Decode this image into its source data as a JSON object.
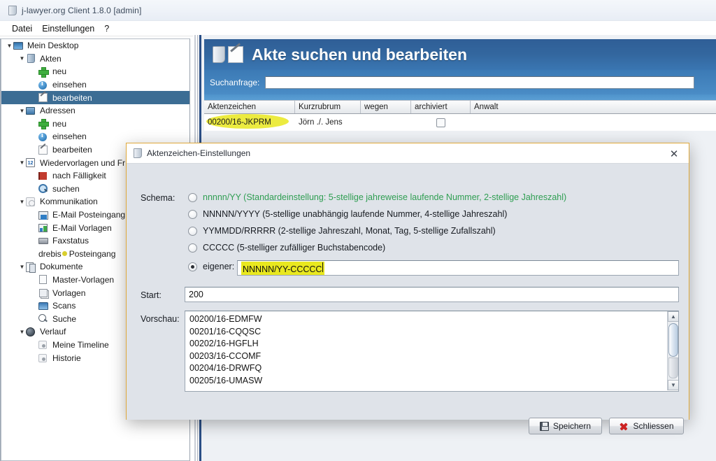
{
  "window": {
    "title": "j-lawyer.org Client 1.8.0 [admin]",
    "icon": "app-folder-icon",
    "menu": [
      "Datei",
      "Einstellungen",
      "?"
    ]
  },
  "sidebar": {
    "items": [
      {
        "label": "Mein Desktop",
        "depth": 0,
        "twisty": "▼",
        "icon": "desktop-icon",
        "selected": false
      },
      {
        "label": "Akten",
        "depth": 1,
        "twisty": "▼",
        "icon": "folder-icon",
        "selected": false
      },
      {
        "label": "neu",
        "depth": 2,
        "twisty": "",
        "icon": "plus-icon",
        "selected": false
      },
      {
        "label": "einsehen",
        "depth": 2,
        "twisty": "",
        "icon": "info-icon",
        "selected": false
      },
      {
        "label": "bearbeiten",
        "depth": 2,
        "twisty": "",
        "icon": "pencil-icon",
        "selected": true
      },
      {
        "label": "Adressen",
        "depth": 1,
        "twisty": "▼",
        "icon": "address-icon",
        "selected": false
      },
      {
        "label": "neu",
        "depth": 2,
        "twisty": "",
        "icon": "plus-icon",
        "selected": false
      },
      {
        "label": "einsehen",
        "depth": 2,
        "twisty": "",
        "icon": "info-icon",
        "selected": false
      },
      {
        "label": "bearbeiten",
        "depth": 2,
        "twisty": "",
        "icon": "pencil-icon",
        "selected": false
      },
      {
        "label": "Wiedervorlagen und Fr",
        "depth": 1,
        "twisty": "▼",
        "icon": "calendar-icon",
        "selected": false,
        "badge": "12"
      },
      {
        "label": "nach Fälligkeit",
        "depth": 2,
        "twisty": "",
        "icon": "flag-icon",
        "selected": false
      },
      {
        "label": "suchen",
        "depth": 2,
        "twisty": "",
        "icon": "magnifier-blue-icon",
        "selected": false
      },
      {
        "label": "Kommunikation",
        "depth": 1,
        "twisty": "▼",
        "icon": "gear-icon",
        "selected": false
      },
      {
        "label": "E-Mail Posteingang",
        "depth": 2,
        "twisty": "",
        "icon": "mail-inbox-icon",
        "selected": false
      },
      {
        "label": "E-Mail Vorlagen",
        "depth": 2,
        "twisty": "",
        "icon": "mail-template-icon",
        "selected": false
      },
      {
        "label": "Faxstatus",
        "depth": 2,
        "twisty": "",
        "icon": "fax-icon",
        "selected": false
      },
      {
        "label": "drebis",
        "depth": 2,
        "twisty": "",
        "icon": "drebis-dot-icon",
        "selected": false,
        "suffix": "Posteingang"
      },
      {
        "label": "Dokumente",
        "depth": 1,
        "twisty": "▼",
        "icon": "documents-icon",
        "selected": false
      },
      {
        "label": "Master-Vorlagen",
        "depth": 2,
        "twisty": "",
        "icon": "document-icon",
        "selected": false
      },
      {
        "label": "Vorlagen",
        "depth": 2,
        "twisty": "",
        "icon": "documents-stack-icon",
        "selected": false
      },
      {
        "label": "Scans",
        "depth": 2,
        "twisty": "",
        "icon": "scanner-icon",
        "selected": false
      },
      {
        "label": "Suche",
        "depth": 2,
        "twisty": "",
        "icon": "search-icon",
        "selected": false
      },
      {
        "label": "Verlauf",
        "depth": 1,
        "twisty": "▼",
        "icon": "clock-icon",
        "selected": false
      },
      {
        "label": "Meine Timeline",
        "depth": 2,
        "twisty": "",
        "icon": "bullet-icon",
        "selected": false
      },
      {
        "label": "Historie",
        "depth": 2,
        "twisty": "",
        "icon": "bullet-icon",
        "selected": false
      }
    ]
  },
  "main": {
    "title": "Akte suchen und bearbeiten",
    "search_label": "Suchanfrage:",
    "search_value": "",
    "search_placeholder": "",
    "table": {
      "columns": [
        "Aktenzeichen",
        "Kurzrubrum",
        "wegen",
        "archiviert",
        "Anwalt"
      ],
      "rows": [
        {
          "aktenzeichen": "00200/16-JKPRM",
          "kurzrubrum": "Jörn ./. Jens",
          "wegen": "",
          "archiviert": false,
          "anwalt": "",
          "highlighted": true
        }
      ]
    }
  },
  "dialog": {
    "title": "Aktenzeichen-Einstellungen",
    "close_label": "✕",
    "schema_label": "Schema:",
    "options": [
      {
        "text": "nnnnn/YY (Standardeinstellung: 5-stellige jahreweise laufende Nummer, 2-stellige Jahreszahl)",
        "selected": false,
        "green": true
      },
      {
        "text": "NNNNN/YYYY (5-stellige unabhängig laufende Nummer, 4-stellige Jahreszahl)",
        "selected": false,
        "green": false
      },
      {
        "text": "YYMMDD/RRRRR (2-stellige Jahreszahl, Monat, Tag, 5-stellige Zufallszahl)",
        "selected": false,
        "green": false
      },
      {
        "text": "CCCCC (5-stelliger zufälliger Buchstabencode)",
        "selected": false,
        "green": false
      },
      {
        "text": "eigener:",
        "selected": true,
        "green": false
      }
    ],
    "custom_value": "NNNNN/YY-CCCCC",
    "start_label": "Start:",
    "start_value": "200",
    "preview_label": "Vorschau:",
    "preview_items": [
      "00200/16-EDMFW",
      "00201/16-CQQSC",
      "00202/16-HGFLH",
      "00203/16-CCOMF",
      "00204/16-DRWFQ",
      "00205/16-UMASW"
    ],
    "buttons": {
      "save": "Speichern",
      "close": "Schliessen"
    },
    "colors": {
      "border": "#e0a93b",
      "option_green": "#2f9e52",
      "highlight_yellow": "#e9e81f"
    }
  }
}
